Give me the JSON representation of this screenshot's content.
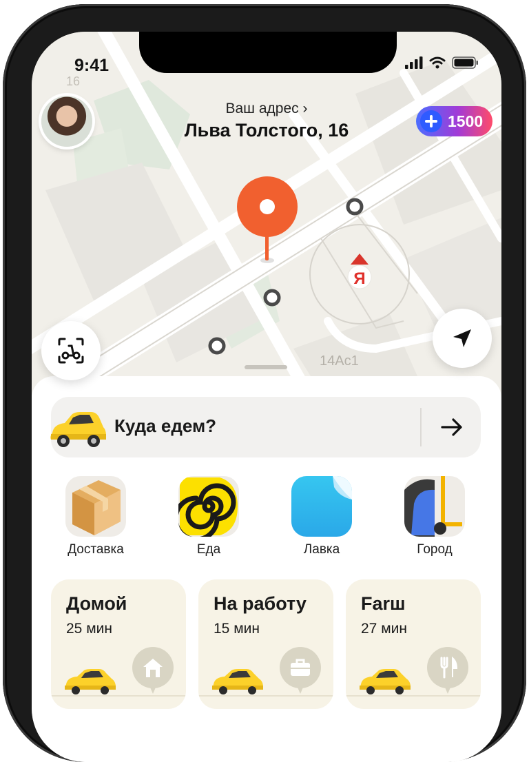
{
  "status_bar": {
    "time": "9:41"
  },
  "header": {
    "address_hint": "Ваш адрес ›",
    "address": "Льва Толстого, 16",
    "plus_points": "1500"
  },
  "map": {
    "building_label": "14Ас1",
    "street_number": "16",
    "brand_letter": "Я"
  },
  "search": {
    "label": "Куда едем?"
  },
  "services": [
    {
      "label": "Доставка",
      "icon": "box-icon"
    },
    {
      "label": "Еда",
      "icon": "spiral-icon"
    },
    {
      "label": "Лавка",
      "icon": "page-curl-icon"
    },
    {
      "label": "Город",
      "icon": "scooter-icon"
    }
  ],
  "shortcuts": [
    {
      "title": "Домой",
      "eta": "25 мин",
      "icon": "home-icon"
    },
    {
      "title": "На работу",
      "eta": "15 мин",
      "icon": "briefcase-icon"
    },
    {
      "title": "Farш",
      "eta": "27 мин",
      "icon": "fork-knife-icon"
    }
  ],
  "colors": {
    "pin": "#f1602f",
    "taxi_yellow": "#fcd12a",
    "card_bg": "#f7f3e6",
    "map_bg": "#f1efe9"
  }
}
